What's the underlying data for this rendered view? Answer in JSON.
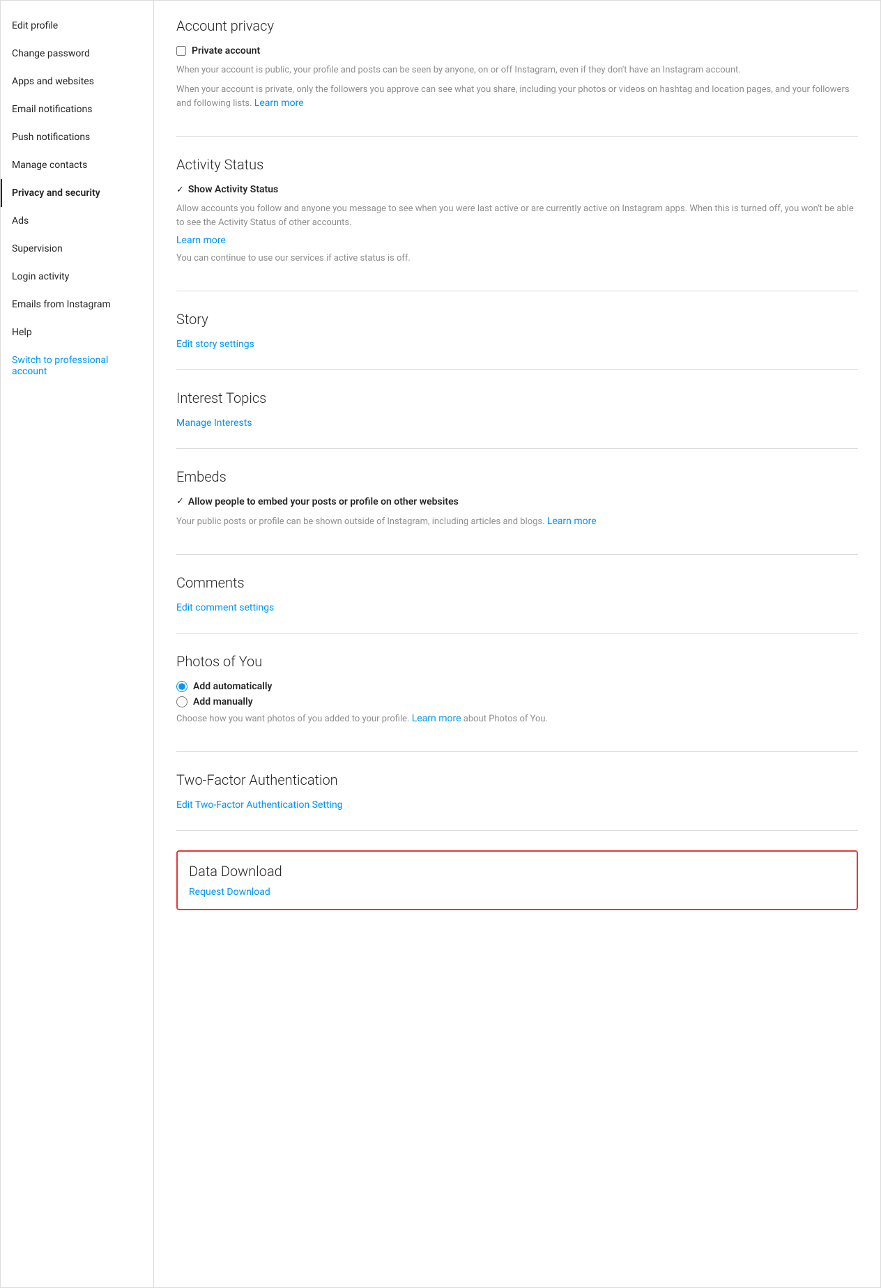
{
  "sidebar": {
    "items": [
      {
        "id": "edit-profile",
        "label": "Edit profile",
        "active": false,
        "blue": false
      },
      {
        "id": "change-password",
        "label": "Change password",
        "active": false,
        "blue": false
      },
      {
        "id": "apps-and-websites",
        "label": "Apps and websites",
        "active": false,
        "blue": false
      },
      {
        "id": "email-notifications",
        "label": "Email notifications",
        "active": false,
        "blue": false
      },
      {
        "id": "push-notifications",
        "label": "Push notifications",
        "active": false,
        "blue": false
      },
      {
        "id": "manage-contacts",
        "label": "Manage contacts",
        "active": false,
        "blue": false
      },
      {
        "id": "privacy-and-security",
        "label": "Privacy and security",
        "active": true,
        "blue": false
      },
      {
        "id": "ads",
        "label": "Ads",
        "active": false,
        "blue": false
      },
      {
        "id": "supervision",
        "label": "Supervision",
        "active": false,
        "blue": false
      },
      {
        "id": "login-activity",
        "label": "Login activity",
        "active": false,
        "blue": false
      },
      {
        "id": "emails-from-instagram",
        "label": "Emails from Instagram",
        "active": false,
        "blue": false
      },
      {
        "id": "help",
        "label": "Help",
        "active": false,
        "blue": false
      },
      {
        "id": "switch-to-professional",
        "label": "Switch to professional account",
        "active": false,
        "blue": true
      }
    ]
  },
  "main": {
    "account_privacy": {
      "title": "Account privacy",
      "checkbox_label": "Private account",
      "description1": "When your account is public, your profile and posts can be seen by anyone, on or off Instagram, even if they don't have an Instagram account.",
      "description2": "When your account is private, only the followers you approve can see what you share, including your photos or videos on hashtag and location pages, and your followers and following lists.",
      "learn_more": "Learn more",
      "checked": false
    },
    "activity_status": {
      "title": "Activity Status",
      "checkmark_label": "Show Activity Status",
      "description": "Allow accounts you follow and anyone you message to see when you were last active or are currently active on Instagram apps. When this is turned off, you won't be able to see the Activity Status of other accounts.",
      "learn_more": "Learn more",
      "extra_text": "You can continue to use our services if active status is off.",
      "checked": true
    },
    "story": {
      "title": "Story",
      "link_label": "Edit story settings"
    },
    "interest_topics": {
      "title": "Interest Topics",
      "link_label": "Manage Interests"
    },
    "embeds": {
      "title": "Embeds",
      "checkmark_label": "Allow people to embed your posts or profile on other websites",
      "description": "Your public posts or profile can be shown outside of Instagram, including articles and blogs.",
      "learn_more": "Learn more",
      "checked": true
    },
    "comments": {
      "title": "Comments",
      "link_label": "Edit comment settings"
    },
    "photos_of_you": {
      "title": "Photos of You",
      "radio1_label": "Add automatically",
      "radio2_label": "Add manually",
      "description": "Choose how you want photos of you added to your profile.",
      "learn_more": "Learn more",
      "learn_more_suffix": "about Photos of You.",
      "radio1_checked": true
    },
    "two_factor_auth": {
      "title": "Two-Factor Authentication",
      "link_label": "Edit Two-Factor Authentication Setting"
    },
    "data_download": {
      "title": "Data Download",
      "link_label": "Request Download"
    }
  }
}
